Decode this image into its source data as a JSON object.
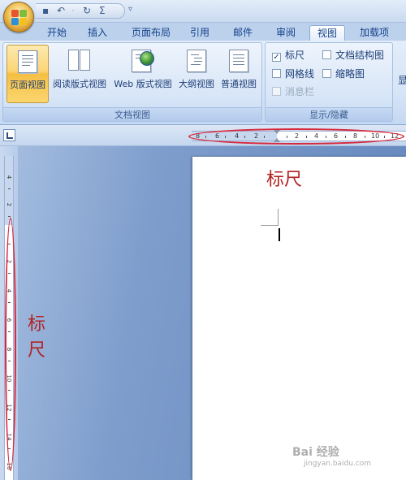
{
  "titlebar": {
    "qat": {
      "save_icon": "save-icon",
      "undo_icon": "undo-icon",
      "redo_icon": "redo-icon",
      "sigma": "Σ",
      "more": "▿"
    }
  },
  "tabs": [
    {
      "label": "开始"
    },
    {
      "label": "插入"
    },
    {
      "label": "页面布局"
    },
    {
      "label": "引用"
    },
    {
      "label": "邮件"
    },
    {
      "label": "审阅"
    },
    {
      "label": "视图",
      "active": true
    },
    {
      "label": "加载项"
    }
  ],
  "ribbon": {
    "doc_views": {
      "label": "文档视图",
      "buttons": [
        {
          "label": "页面视图",
          "active": true
        },
        {
          "label": "阅读版式视图"
        },
        {
          "label": "Web 版式视图"
        },
        {
          "label": "大纲视图"
        },
        {
          "label": "普通视图"
        }
      ]
    },
    "show_hide": {
      "label": "显示/隐藏",
      "items": [
        {
          "label": "标尺",
          "checked": true,
          "enabled": true
        },
        {
          "label": "文档结构图",
          "checked": false,
          "enabled": true
        },
        {
          "label": "网格线",
          "checked": false,
          "enabled": true
        },
        {
          "label": "缩略图",
          "checked": false,
          "enabled": true
        },
        {
          "label": "消息栏",
          "checked": false,
          "enabled": false
        }
      ],
      "check_mark": "✓"
    },
    "cut_button": "显"
  },
  "rulers": {
    "horizontal_numbers": [
      "8",
      "6",
      "4",
      "2",
      "2",
      "4",
      "6",
      "8",
      "10",
      "12"
    ],
    "vertical_numbers": [
      "4",
      "2",
      "2",
      "4",
      "6",
      "8",
      "10",
      "12",
      "14",
      "16"
    ]
  },
  "annotations": {
    "top": "标尺",
    "left": "标尺"
  },
  "watermark": {
    "brand": "Bai 经验",
    "url": "jingyan.baidu.com"
  },
  "colors": {
    "annotation": "#b22222",
    "ellipse": "#d8283c",
    "active_button": "#fbd575",
    "tab_text": "#15428b"
  }
}
